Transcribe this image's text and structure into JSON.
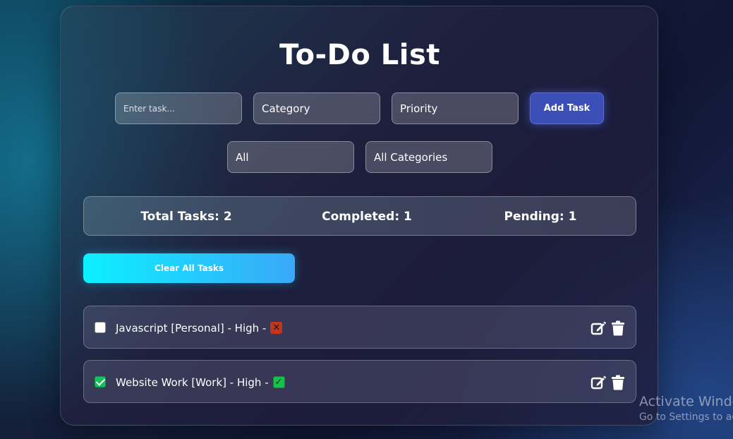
{
  "app": {
    "title": "To-Do List"
  },
  "form": {
    "task_placeholder": "Enter task...",
    "category_label": "Category",
    "priority_label": "Priority",
    "add_button": "Add Task"
  },
  "filters": {
    "status_filter": "All",
    "category_filter": "All Categories"
  },
  "stats": {
    "total": "Total Tasks: 2",
    "completed": "Completed: 1",
    "pending": "Pending: 1"
  },
  "actions": {
    "clear_all": "Clear All Tasks"
  },
  "tasks": [
    {
      "text": "Javascript [Personal] - High -",
      "status_icon": "cross-mark-icon",
      "status_glyph": "✕",
      "checked": false
    },
    {
      "text": "Website Work [Work] - High -",
      "status_icon": "check-mark-icon",
      "status_glyph": "✓",
      "checked": true
    }
  ],
  "watermark": {
    "line1": "Activate Windo",
    "line2": "Go to Settings to act"
  },
  "colors": {
    "add_button": "#3c4fb8",
    "clear_gradient_start": "#0cf0ff",
    "clear_gradient_end": "#3aa8f8",
    "checked": "#12c25c",
    "fail_icon": "#c6341e"
  }
}
